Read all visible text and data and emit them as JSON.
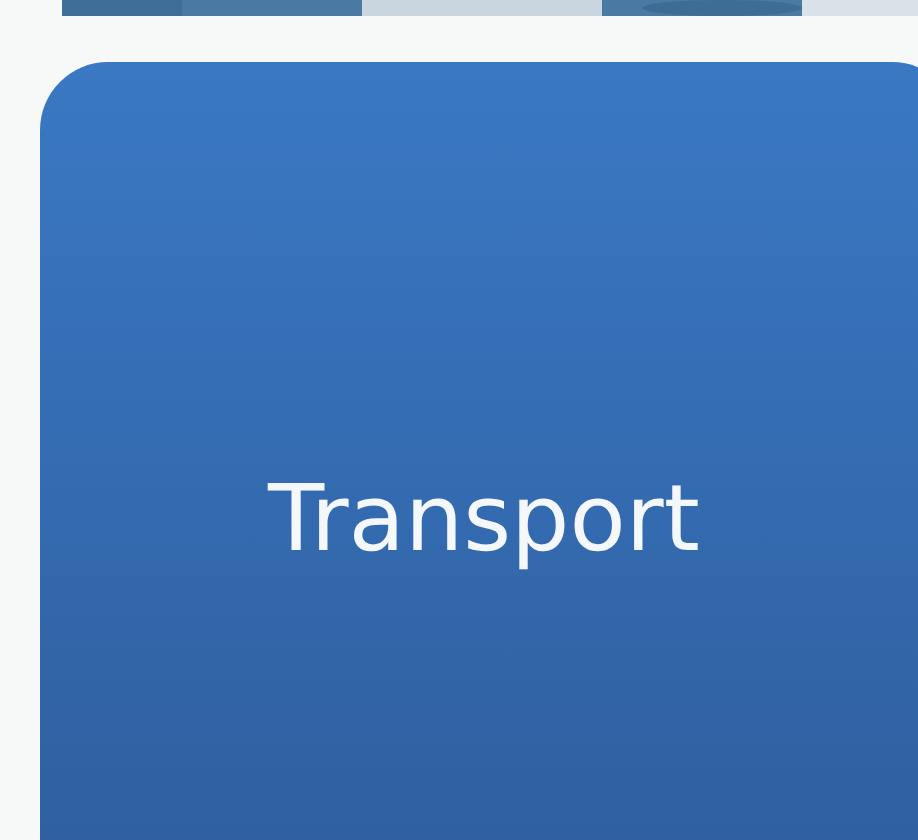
{
  "tile": {
    "label": "Transport"
  }
}
